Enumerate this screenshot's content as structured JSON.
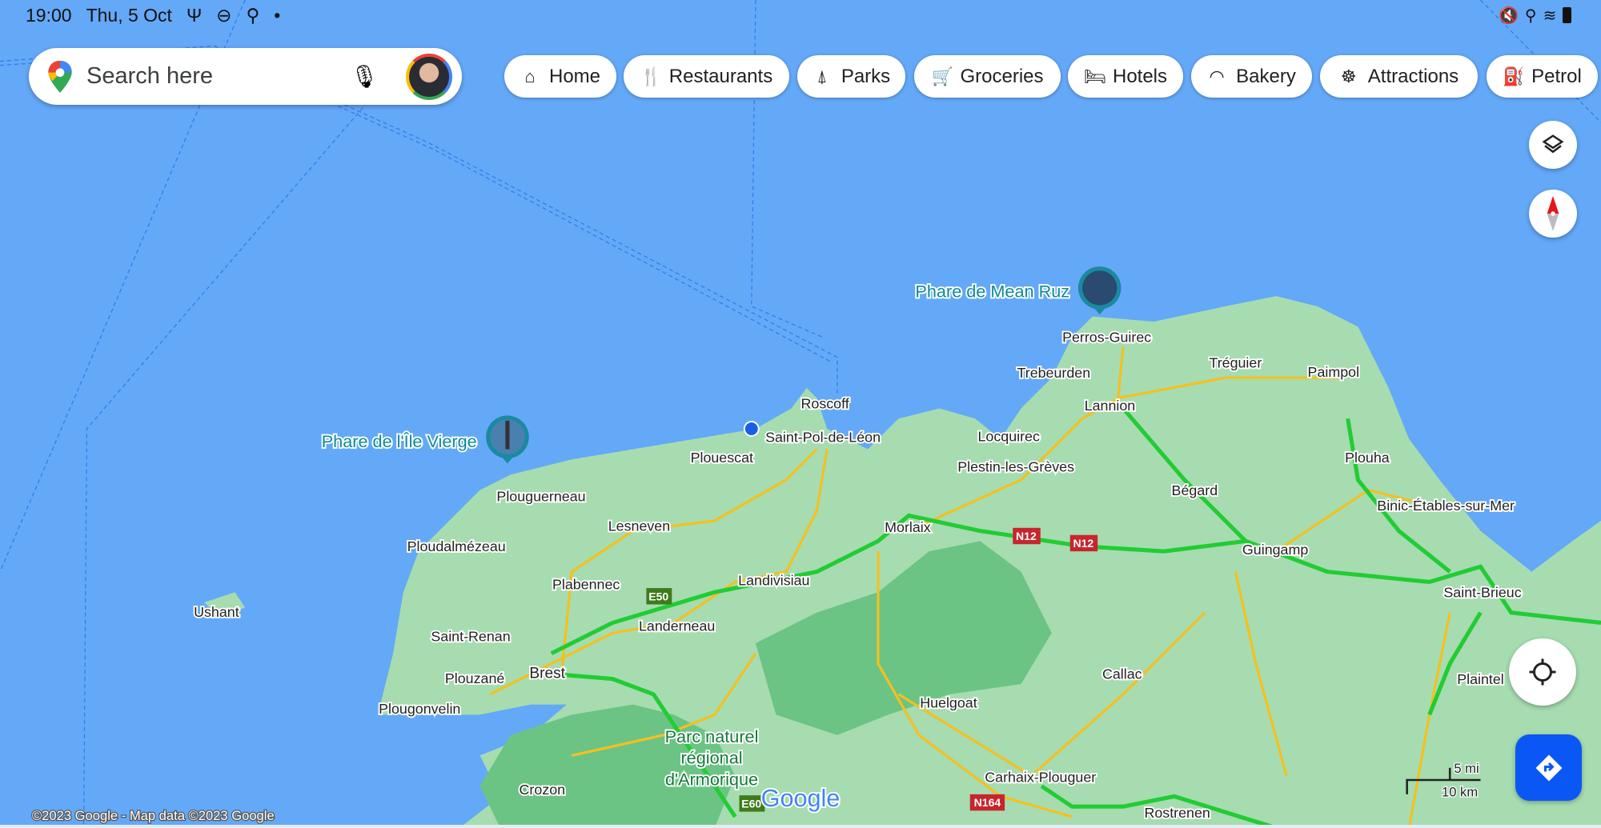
{
  "status_bar": {
    "time": "19:00",
    "date": "Thu, 5 Oct",
    "left_icons": [
      "usb-icon",
      "do-not-disturb-icon",
      "location-icon",
      "dot-icon"
    ],
    "right_icons": [
      "mute-icon",
      "location-icon",
      "wifi-icon",
      "battery-icon"
    ]
  },
  "search": {
    "placeholder": "Search here",
    "icons": [
      "google-maps-pin-icon",
      "microphone-icon",
      "avatar"
    ]
  },
  "chips": [
    {
      "label": "Home",
      "icon": "home-icon"
    },
    {
      "label": "Restaurants",
      "icon": "restaurant-icon"
    },
    {
      "label": "Parks",
      "icon": "tree-icon"
    },
    {
      "label": "Groceries",
      "icon": "cart-icon"
    },
    {
      "label": "Hotels",
      "icon": "bed-icon"
    },
    {
      "label": "Bakery",
      "icon": "bakery-icon"
    },
    {
      "label": "Attractions",
      "icon": "attractions-icon"
    },
    {
      "label": "Petrol",
      "icon": "petrol-icon"
    }
  ],
  "map": {
    "places": [
      "Roscoff",
      "Saint-Pol-de-Léon",
      "Plouescat",
      "Plouguerneau",
      "Lesneven",
      "Ploudalmézeau",
      "Plabennec",
      "Landivisiau",
      "Morlaix",
      "Ushant",
      "Saint-Renan",
      "Landerneau",
      "Brest",
      "Plouzané",
      "Plougonvelin",
      "Crozon",
      "Huelgoat",
      "Callac",
      "Carhaix-Plouguer",
      "Rostrenen",
      "Locquirec",
      "Plestin-les-Grèves",
      "Lannion",
      "Trebeurden",
      "Perros-Guirec",
      "Tréguier",
      "Paimpol",
      "Plouha",
      "Bégard",
      "Guingamp",
      "Binic-Étables-sur-Mer",
      "Saint-Brieuc",
      "Plaintel"
    ],
    "park": [
      "Parc naturel",
      "régional",
      "d'Armorique"
    ],
    "pois": [
      "Phare de Mean Ruz",
      "Phare de l'Île Vierge"
    ],
    "road_badges": [
      "N12",
      "N12",
      "E50",
      "E60",
      "N164"
    ],
    "logo": "Google",
    "copyright": "©2023 Google - Map data ©2023 Google",
    "scale": {
      "imperial": "5 mi",
      "metric": "10 km"
    },
    "colors": {
      "water": "#64a8f8",
      "land": "#a6dcb0",
      "forest": "#6cc484",
      "highway": "#22cc33",
      "main_road": "#f4c020",
      "badge_n": "#c8252c",
      "badge_e": "#3f7a1c"
    }
  }
}
